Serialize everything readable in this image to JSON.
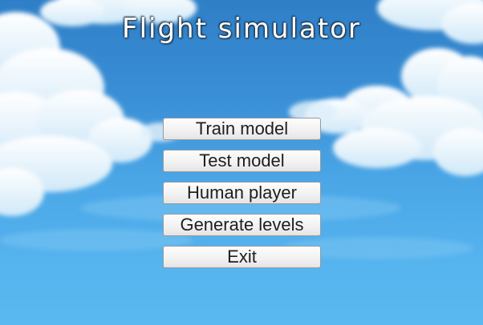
{
  "title": "Flight simulator",
  "menu": {
    "train_label": "Train model",
    "test_label": "Test model",
    "human_label": "Human player",
    "generate_label": "Generate levels",
    "exit_label": "Exit"
  },
  "colors": {
    "sky_top": "#2f7fc7",
    "sky_bottom": "#5ab9f0",
    "cloud": "#ffffff",
    "button_bg": "#f1f1f1",
    "button_text": "#1e1e1e"
  }
}
